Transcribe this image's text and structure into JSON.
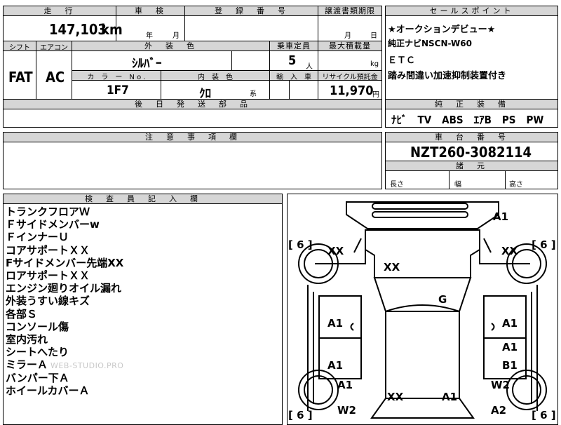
{
  "top": {
    "mileage_label": "走　行",
    "mileage_value": "147,103",
    "mileage_unit": "km",
    "shaken_label": "車　検",
    "shaken_year": "年",
    "shaken_month": "月",
    "registration_label": "登　録　番　号",
    "transfer_label": "譲渡書類期限",
    "transfer_month": "月",
    "transfer_day": "日"
  },
  "row2": {
    "shift_label": "シフト",
    "shift_value": "FAT",
    "aircon_label": "エアコン",
    "aircon_value": "AC",
    "exterior_label": "外　装　色",
    "exterior_value": "ｼﾙﾊﾞｰ",
    "capacity_label": "乗車定員",
    "capacity_value": "5",
    "capacity_unit": "人",
    "maxload_label": "最大積載量",
    "maxload_unit": "kg",
    "colorno_label": "カ　ラ　ー　N o .",
    "colorno_value": "1F7",
    "interior_label": "内　装　色",
    "interior_value": "ｸﾛ",
    "interior_suffix": "系",
    "import_label": "輸　入　車",
    "recycle_label": "リサイクル預託金",
    "recycle_value": "11,970",
    "recycle_unit": "円",
    "later_label": "後　日　発　送　部　品"
  },
  "sales": {
    "header": "セールスポイント",
    "lines": [
      "★オークションデビュー★",
      "純正ナビNSCN-W60",
      "ＥＴＣ",
      "踏み間違い加速抑制装置付き"
    ]
  },
  "equipment": {
    "header": "純　正　装　備",
    "items": "ﾅﾋﾞ　TV　ABS　ｴｱB　PS　PW"
  },
  "caution": {
    "header": "注　意　事　項　欄"
  },
  "chassis": {
    "header": "車　台　番　号",
    "value": "NZT260-3082114",
    "dims_header": "諸　元",
    "length_label": "長さ",
    "width_label": "幅",
    "height_label": "高さ"
  },
  "inspector": {
    "header": "検　査　員　記　入　欄",
    "notes": [
      "トランクフロアＷ",
      "Ｆサイドメンバーw",
      "ＦインナーＵ",
      "コアサポートＸＸ",
      "Fサイドメンバー先端XX",
      "ロアサポートＸＸ",
      "エンジン廻りオイル漏れ",
      "外装うすい線キズ",
      "各部Ｓ",
      "コンソール傷",
      "室内汚れ",
      "シートへたり",
      "ミラーＡ",
      "バンパー下Ａ",
      "ホイールカバーＡ"
    ],
    "watermark": "WEB-STUDIO.PRO"
  },
  "diagram": {
    "bracket_6": "[ 6 ]",
    "labels": {
      "rear_right": "A1",
      "trunk_left": "XX",
      "trunk_right": "XX",
      "trunk_center": "XX",
      "roof": "G",
      "left_rear_door": "A1",
      "right_rear_door": "A1",
      "right_front_door_a": "A1",
      "left_front_door": "A1",
      "right_front_door_b": "B1",
      "left_fender": "A1",
      "right_fender": "W2",
      "left_front_corner": "W2",
      "right_front_corner": "A2",
      "hood_left": "XX",
      "hood_right": "A1"
    }
  }
}
